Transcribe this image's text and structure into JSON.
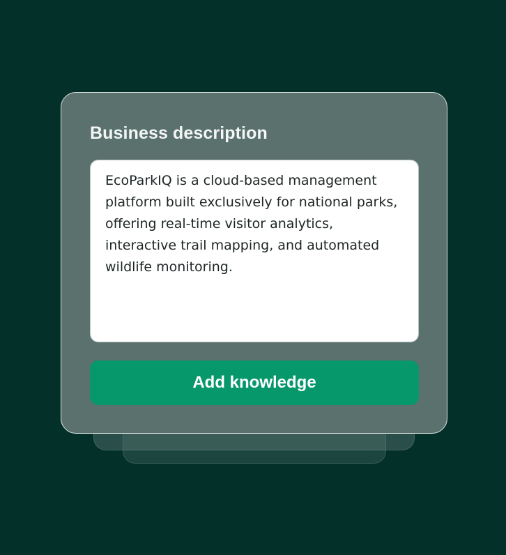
{
  "card": {
    "title": "Business description",
    "description_value": "EcoParkIQ is a cloud-based management platform built exclusively for national parks, offering real-time visitor analytics, interactive trail mapping, and automated wildlife monitoring.",
    "button_label": "Add knowledge"
  },
  "colors": {
    "background": "#04302a",
    "card": "#5a716d",
    "accent": "#06976a"
  }
}
